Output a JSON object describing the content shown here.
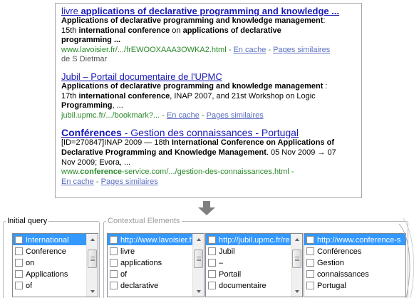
{
  "results": [
    {
      "title_parts": [
        {
          "text": "livre ",
          "bold": false
        },
        {
          "text": "applications of declarative programming and knowledge ...",
          "bold": true
        }
      ],
      "snippet_lines": [
        [
          {
            "text": "Applications of declarative programming and knowledge management",
            "bold": true
          },
          {
            "text": ":",
            "bold": false
          }
        ],
        [
          {
            "text": "15th ",
            "bold": false
          },
          {
            "text": "international conference",
            "bold": true
          },
          {
            "text": " on ",
            "bold": false
          },
          {
            "text": "applications of declarative",
            "bold": true
          }
        ],
        [
          {
            "text": "programming ...",
            "bold": true
          }
        ]
      ],
      "url": "www.lavoisier.fr/.../frEWOOXAAA3OWKA2.html",
      "links": [
        "En cache",
        "Pages similaires"
      ],
      "extra": "de S Dietmar"
    },
    {
      "title_parts": [
        {
          "text": "Jubil – Portail documentaire de l'UPMC",
          "bold": false
        }
      ],
      "snippet_lines": [
        [
          {
            "text": "Applications of declarative programming and knowledge management",
            "bold": true
          },
          {
            "text": " :",
            "bold": false
          }
        ],
        [
          {
            "text": "17th ",
            "bold": false
          },
          {
            "text": "international conference",
            "bold": true
          },
          {
            "text": ", INAP 2007, and 21st Workshop on Logic",
            "bold": false
          }
        ],
        [
          {
            "text": "Programming",
            "bold": true
          },
          {
            "text": ", ...",
            "bold": false
          }
        ]
      ],
      "url": "jubil.upmc.fr/.../bookmark?...",
      "links": [
        "En cache",
        "Pages similaires"
      ],
      "extra": ""
    },
    {
      "title_parts": [
        {
          "text": "Conférences",
          "bold": true
        },
        {
          "text": " - Gestion des connaissances - Portugal",
          "bold": false
        }
      ],
      "snippet_lines": [
        [
          {
            "text": "[ID=270847]INAP 2009 — 18th ",
            "bold": false
          },
          {
            "text": "International Conference on Applications of",
            "bold": true
          }
        ],
        [
          {
            "text": "Declarative Programming and Knowledge Management",
            "bold": true
          },
          {
            "text": ". 05 Nov 2009 → 07",
            "bold": false
          }
        ],
        [
          {
            "text": "Nov 2009; Evora, ...",
            "bold": false
          }
        ]
      ],
      "url_parts": [
        {
          "text": "www.",
          "bold": false
        },
        {
          "text": "conference",
          "bold": true
        },
        {
          "text": "-service.com/.../gestion-des-connaissances.html -",
          "bold": false
        }
      ],
      "links": [
        "En cache",
        "Pages similaires"
      ],
      "extra": ""
    }
  ],
  "initial_query": {
    "legend": "Initial query",
    "items": [
      "International",
      "Conference",
      "on",
      "Applications",
      "of"
    ],
    "selected_index": 0
  },
  "contextual_elements": {
    "legend": "Contextual Elements",
    "lists": [
      {
        "items": [
          "http://www.lavoisier.f",
          "livre",
          "applications",
          "of",
          "declarative"
        ],
        "selected_index": 0
      },
      {
        "items": [
          "http://jubil.upmc.fr/re",
          "Jubil",
          "–",
          "Portail",
          "documentaire"
        ],
        "selected_index": 0
      },
      {
        "items": [
          "http://www.conference-s",
          "Conférences",
          "Gestion",
          "connaissances",
          "Portugal"
        ],
        "selected_index": 0
      }
    ]
  },
  "icons": {
    "arrow": "down-arrow-icon",
    "checkbox": "checkbox-icon",
    "scroll_up": "chevron-up-icon",
    "scroll_down": "chevron-down-icon"
  },
  "colors": {
    "link_blue": "#1a1ab8",
    "url_green": "#2b8a2b",
    "sublink": "#5c6fbf",
    "selection": "#3399ff",
    "arrow_gray": "#7f7f7f"
  }
}
